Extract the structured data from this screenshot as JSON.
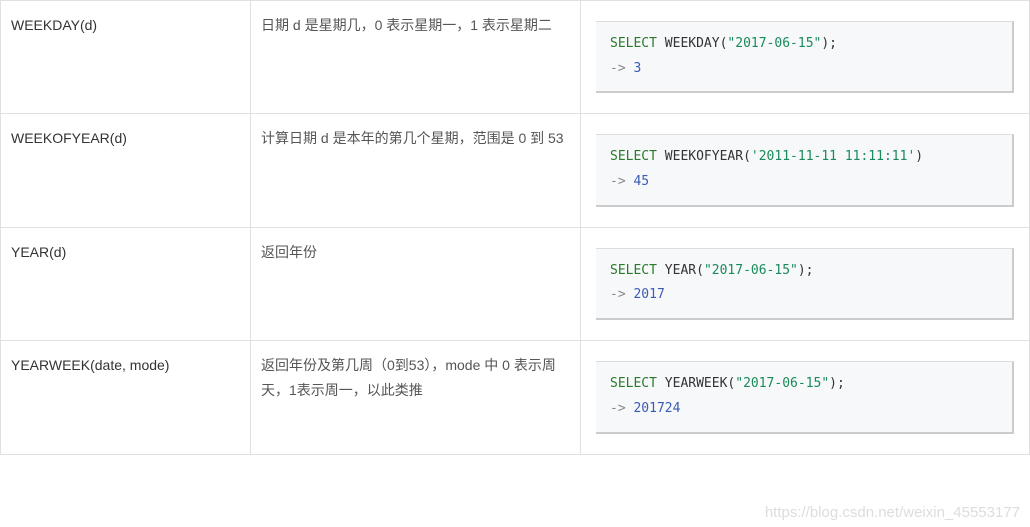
{
  "rows": [
    {
      "func": "WEEKDAY(d)",
      "desc": "日期 d 是星期几，0 表示星期一，1 表示星期二",
      "code_parts": [
        "SELECT",
        "WEEKDAY",
        "(",
        "\"2017-06-15\"",
        ");",
        "->",
        "3"
      ]
    },
    {
      "func": "WEEKOFYEAR(d)",
      "desc": "计算日期 d 是本年的第几个星期，范围是 0 到 53",
      "code_parts": [
        "SELECT",
        "WEEKOFYEAR",
        "(",
        "'2011-11-11 11:11:11'",
        ")",
        "->",
        "45"
      ]
    },
    {
      "func": "YEAR(d)",
      "desc": "返回年份",
      "code_parts": [
        "SELECT",
        "YEAR",
        "(",
        "\"2017-06-15\"",
        ");",
        "->",
        "2017"
      ]
    },
    {
      "func": "YEARWEEK(date, mode)",
      "desc": "返回年份及第几周（0到53），mode 中 0 表示周天，1表示周一，以此类推",
      "code_parts": [
        "SELECT",
        "YEARWEEK",
        "(",
        "\"2017-06-15\"",
        ");",
        "->",
        "201724"
      ]
    }
  ],
  "watermark": "https://blog.csdn.net/weixin_45553177"
}
